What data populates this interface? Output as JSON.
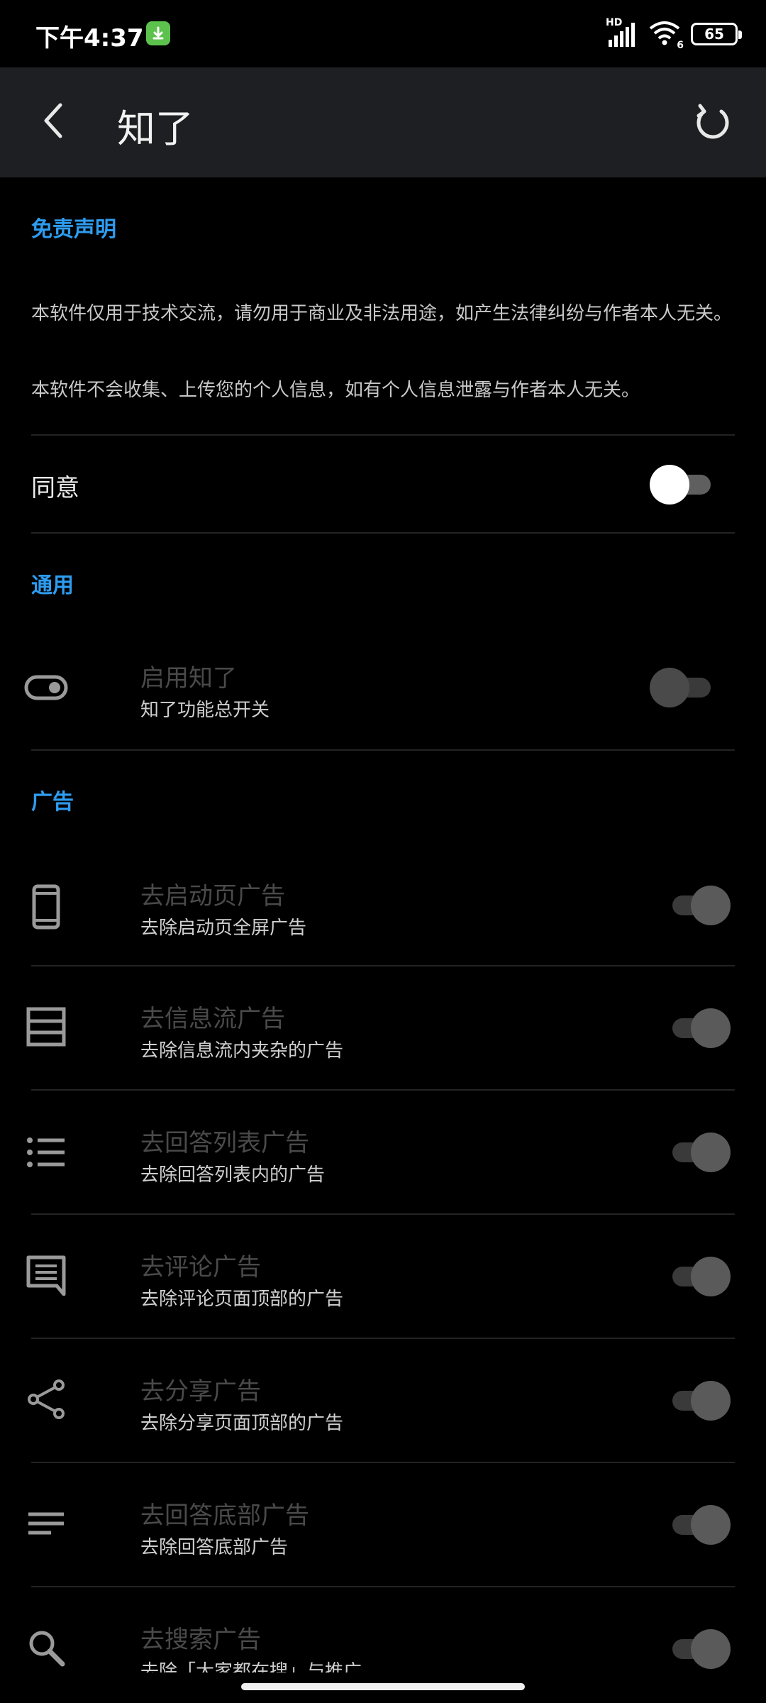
{
  "status_bar": {
    "time": "下午4:37",
    "network": "HD",
    "wifi_label": "6",
    "battery": "65"
  },
  "app_bar": {
    "title": "知了"
  },
  "disclaimer": {
    "header": "免责声明",
    "paragraph1": "本软件仅用于技术交流，请勿用于商业及非法用途，如产生法律纠纷与作者本人无关。",
    "paragraph2": "本软件不会收集、上传您的个人信息，如有个人信息泄露与作者本人无关。",
    "agree_label": "同意",
    "agree_on": false
  },
  "general": {
    "header": "通用",
    "items": [
      {
        "title": "启用知了",
        "subtitle": "知了功能总开关",
        "icon": "toggle-icon",
        "on": false
      }
    ]
  },
  "ads": {
    "header": "广告",
    "items": [
      {
        "title": "去启动页广告",
        "subtitle": "去除启动页全屏广告",
        "icon": "phone-icon",
        "on": true
      },
      {
        "title": "去信息流广告",
        "subtitle": "去除信息流内夹杂的广告",
        "icon": "feed-icon",
        "on": true
      },
      {
        "title": "去回答列表广告",
        "subtitle": "去除回答列表内的广告",
        "icon": "list-icon",
        "on": true
      },
      {
        "title": "去评论广告",
        "subtitle": "去除评论页面顶部的广告",
        "icon": "comment-icon",
        "on": true
      },
      {
        "title": "去分享广告",
        "subtitle": "去除分享页面顶部的广告",
        "icon": "share-icon",
        "on": true
      },
      {
        "title": "去回答底部广告",
        "subtitle": "去除回答底部广告",
        "icon": "lines-icon",
        "on": true
      },
      {
        "title": "去搜索广告",
        "subtitle": "去除「大家都在搜」与推广",
        "icon": "search-icon",
        "on": true
      }
    ]
  },
  "colors": {
    "accent": "#2e9cf0",
    "background": "#000000",
    "appbar": "#1e1f22"
  }
}
